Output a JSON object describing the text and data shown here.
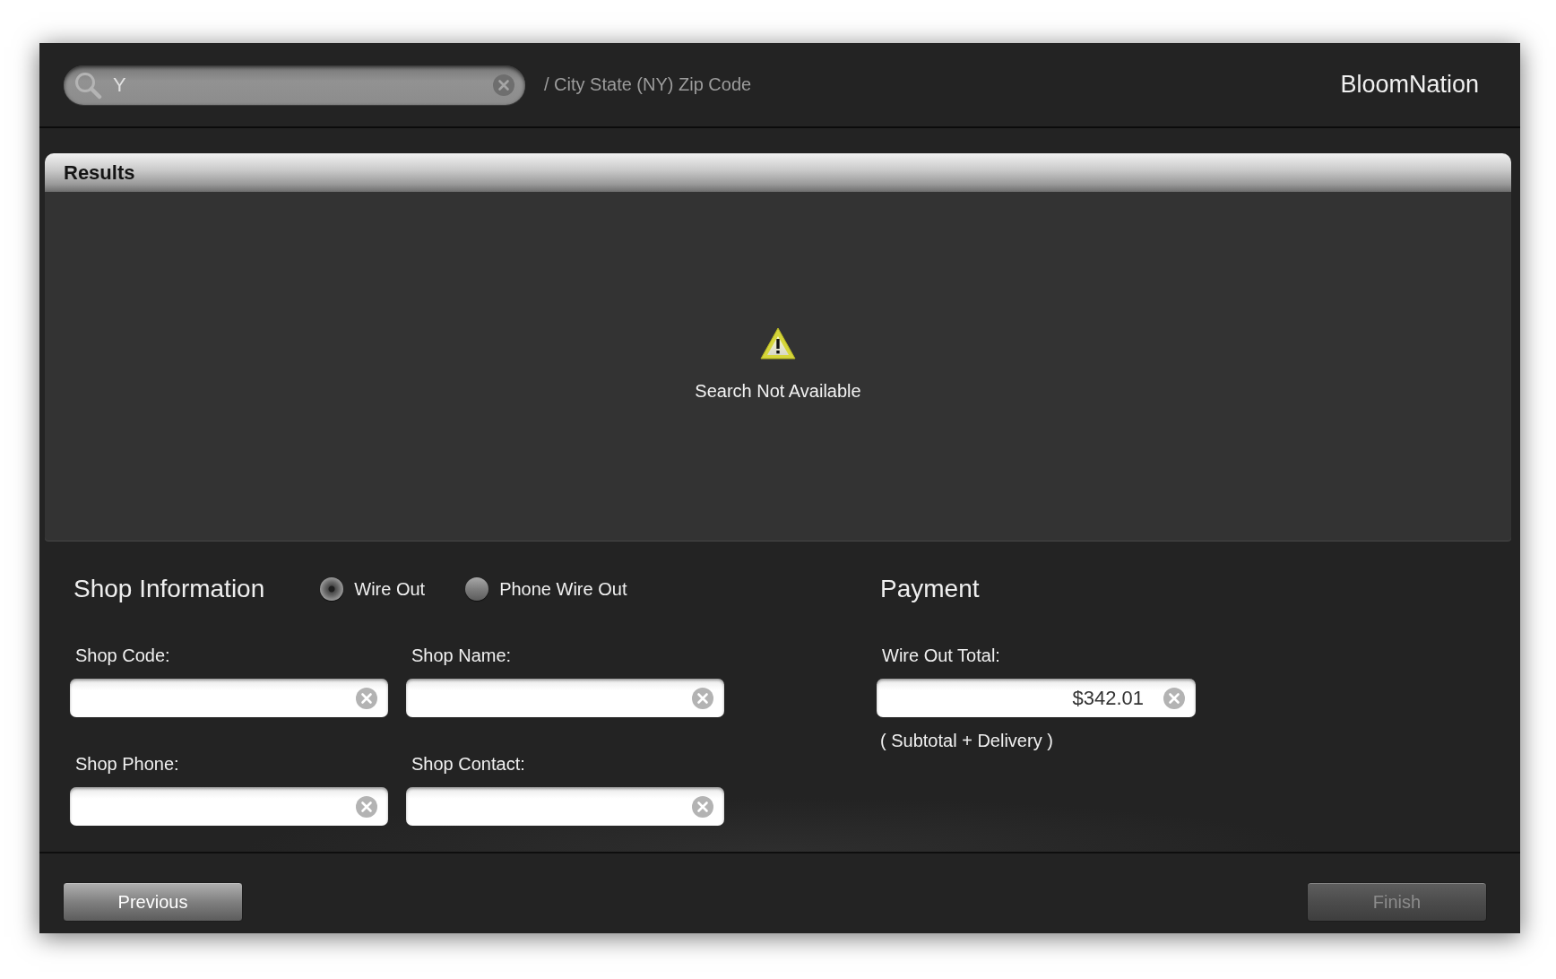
{
  "search_bar": {
    "value": "Y",
    "hint": "/ City State (NY) Zip Code"
  },
  "brand": "BloomNation",
  "results": {
    "title": "Results",
    "message": "Search Not Available"
  },
  "shop_information": {
    "title": "Shop Information",
    "options": [
      {
        "label": "Wire Out",
        "selected": true
      },
      {
        "label": "Phone Wire Out",
        "selected": false
      }
    ],
    "fields": [
      {
        "label": "Shop Code:"
      },
      {
        "label": "Shop Name:"
      },
      {
        "label": "Shop Phone:"
      },
      {
        "label": "Shop Contact:"
      }
    ]
  },
  "payment": {
    "title": "Payment",
    "fields": [
      {
        "label": "Wire Out Total:",
        "value": "$342.01",
        "note": "( Subtotal + Delivery )"
      }
    ]
  },
  "buttons": [
    {
      "label": "Previous",
      "disabled": false
    },
    {
      "label": "Finish",
      "disabled": true
    }
  ]
}
